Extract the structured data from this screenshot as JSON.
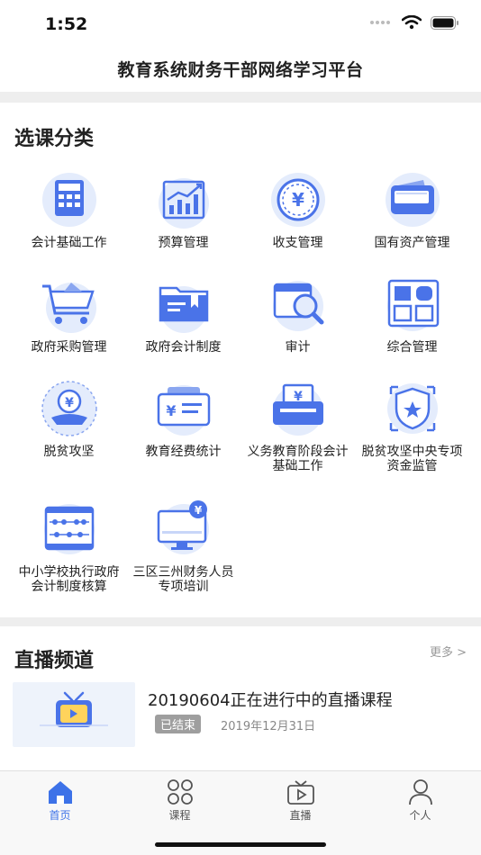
{
  "status": {
    "time": "1:52"
  },
  "header": {
    "title": "教育系统财务干部网络学习平台"
  },
  "categories": {
    "title": "选课分类",
    "items": [
      {
        "label": "会计基础工作",
        "icon": "calculator-icon"
      },
      {
        "label": "预算管理",
        "icon": "bar-chart-icon"
      },
      {
        "label": "收支管理",
        "icon": "yuan-coin-icon"
      },
      {
        "label": "国有资产管理",
        "icon": "wallet-icon"
      },
      {
        "label": "政府采购管理",
        "icon": "shopping-cart-icon"
      },
      {
        "label": "政府会计制度",
        "icon": "folder-icon"
      },
      {
        "label": "审计",
        "icon": "magnifier-document-icon"
      },
      {
        "label": "综合管理",
        "icon": "grid-icon"
      },
      {
        "label": "脱贫攻坚",
        "icon": "coin-hand-icon"
      },
      {
        "label": "教育经费统计",
        "icon": "cash-icon"
      },
      {
        "label": "义务教育阶段会计基础工作",
        "icon": "money-printer-icon"
      },
      {
        "label": "脱贫攻坚中央专项资金监管",
        "icon": "shield-star-icon"
      },
      {
        "label": "中小学校执行政府会计制度核算",
        "icon": "abacus-icon"
      },
      {
        "label": "三区三州财务人员专项培训",
        "icon": "monitor-yuan-icon"
      }
    ]
  },
  "live": {
    "title": "直播频道",
    "more": "更多 >",
    "items": [
      {
        "title": "20190604正在进行中的直播课程",
        "status": "已结束",
        "date": "2019年12月31日"
      }
    ]
  },
  "tabs": [
    {
      "label": "首页",
      "icon": "home-icon",
      "active": true
    },
    {
      "label": "课程",
      "icon": "courses-grid-icon",
      "active": false
    },
    {
      "label": "直播",
      "icon": "tv-icon",
      "active": false
    },
    {
      "label": "个人",
      "icon": "user-icon",
      "active": false
    }
  ],
  "colors": {
    "accent": "#3d72e8",
    "icon_blue": "#4a73e8",
    "icon_light": "#e4ecfc",
    "separator": "#eeeeee"
  }
}
